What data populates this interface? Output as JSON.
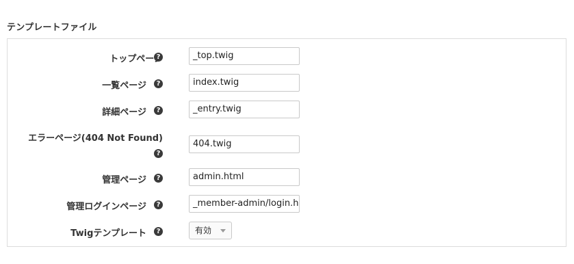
{
  "section": {
    "title": "テンプレートファイル"
  },
  "fields": [
    {
      "label": "トップページ",
      "value": "_top.twig"
    },
    {
      "label": "一覧ページ",
      "value": "index.twig"
    },
    {
      "label": "詳細ページ",
      "value": "_entry.twig"
    },
    {
      "label": "エラーページ(404 Not Found)",
      "value": "404.twig"
    },
    {
      "label": "管理ページ",
      "value": "admin.html"
    },
    {
      "label": "管理ログインページ",
      "value": "_member-admin/login.h"
    },
    {
      "label": "Twigテンプレート",
      "value": "有効"
    }
  ],
  "help_icon": {
    "glyph": "?",
    "icon": "question-circle-icon"
  }
}
